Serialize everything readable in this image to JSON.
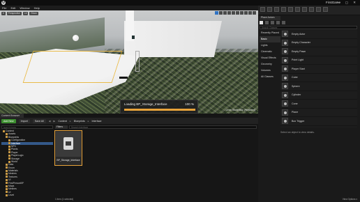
{
  "app": {
    "project_name": "FirstGame",
    "window_controls": "— ▢ ✕",
    "logo": "U"
  },
  "menu": [
    "File",
    "Edit",
    "Window",
    "Help"
  ],
  "viewport": {
    "toolbar_left": [
      "Perspective",
      "Lit",
      "Show"
    ],
    "loading": {
      "text": "Loading BP_Storage_Interface",
      "percent_label": "100 %",
      "progress": 1.0
    },
    "caption": "Level: StarterMap (Persistent)"
  },
  "modes": {
    "tab": "Place Actors",
    "search_placeholder": "Search Classes",
    "categories": [
      "Recently Placed",
      "Basic",
      "Lights",
      "Cinematic",
      "Visual Effects",
      "Geometry",
      "Volumes",
      "All Classes"
    ],
    "selected_category": 1,
    "items": [
      "Empty Actor",
      "Empty Character",
      "Empty Pawn",
      "Point Light",
      "Player Start",
      "Cube",
      "Sphere",
      "Cylinder",
      "Cone",
      "Plane",
      "Box Trigger"
    ]
  },
  "details": {
    "empty_text": "Select an object to view details."
  },
  "content_browser": {
    "tab": "Content Browser",
    "add_new": "Add New",
    "import": "Import",
    "save_all": "Save All",
    "breadcrumbs": [
      "Content",
      "Blueprints",
      "Interface"
    ],
    "filters": "Filters",
    "search_paths_placeholder": "Search Paths",
    "search_assets_placeholder": "Search Interface",
    "tree": [
      {
        "label": "Content",
        "depth": 0
      },
      {
        "label": "Assets",
        "depth": 1
      },
      {
        "label": "Blueprints",
        "depth": 1
      },
      {
        "label": "Configuration",
        "depth": 2
      },
      {
        "label": "Interface",
        "depth": 2,
        "selected": true
      },
      {
        "label": "NPC",
        "depth": 2
      },
      {
        "label": "Plants",
        "depth": 2
      },
      {
        "label": "Player",
        "depth": 2
      },
      {
        "label": "PlayerLogic",
        "depth": 2
      },
      {
        "label": "Storage",
        "depth": 2
      },
      {
        "label": "World",
        "depth": 2
      },
      {
        "label": "Data",
        "depth": 1
      },
      {
        "label": "Enum",
        "depth": 1
      },
      {
        "label": "Materials",
        "depth": 1
      },
      {
        "label": "Meshes",
        "depth": 1
      },
      {
        "label": "Textures",
        "depth": 1
      },
      {
        "label": "UI",
        "depth": 1
      },
      {
        "label": "FirstPersonBP",
        "depth": 1
      },
      {
        "label": "Maps",
        "depth": 1
      },
      {
        "label": "Meshes",
        "depth": 1
      },
      {
        "label": "UI",
        "depth": 1
      },
      {
        "label": "Level",
        "depth": 1
      }
    ],
    "asset": {
      "name": "BP_Storage_Interface"
    },
    "status": "1 item (1 selected)",
    "view_options": "View Options ▾"
  }
}
